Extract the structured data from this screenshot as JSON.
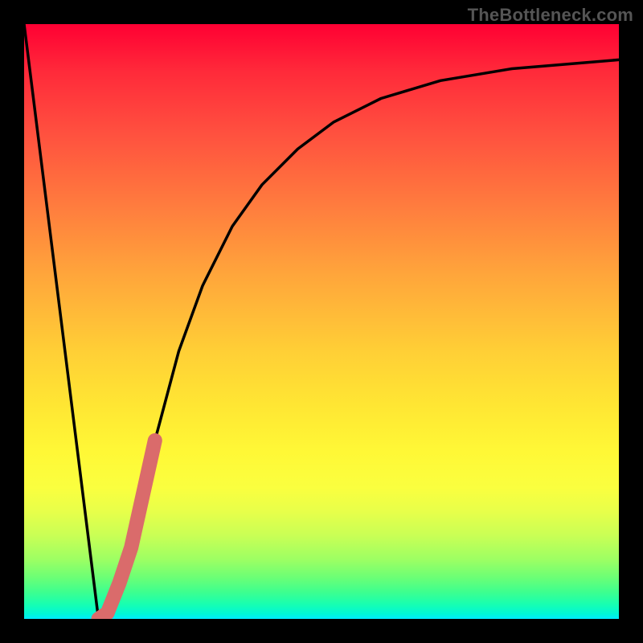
{
  "attribution": "TheBottleneck.com",
  "chart_data": {
    "type": "line",
    "title": "",
    "xlabel": "",
    "ylabel": "",
    "xlim": [
      0,
      100
    ],
    "ylim": [
      0,
      100
    ],
    "series": [
      {
        "name": "curve",
        "color": "#000000",
        "x": [
          0,
          5,
          10,
          12.5,
          15,
          18,
          22,
          26,
          30,
          35,
          40,
          46,
          52,
          60,
          70,
          82,
          100
        ],
        "y": [
          100,
          60,
          20,
          0,
          2,
          12,
          30,
          45,
          56,
          66,
          73,
          79,
          83.5,
          87.5,
          90.5,
          92.5,
          94
        ]
      },
      {
        "name": "highlight-segment",
        "color": "#da6b6b",
        "x": [
          12.5,
          14,
          16,
          18,
          20,
          22
        ],
        "y": [
          0,
          1,
          6,
          12,
          21,
          30
        ]
      }
    ]
  },
  "colors": {
    "curve": "#000000",
    "highlight": "#da6b6b",
    "frame": "#000000"
  }
}
